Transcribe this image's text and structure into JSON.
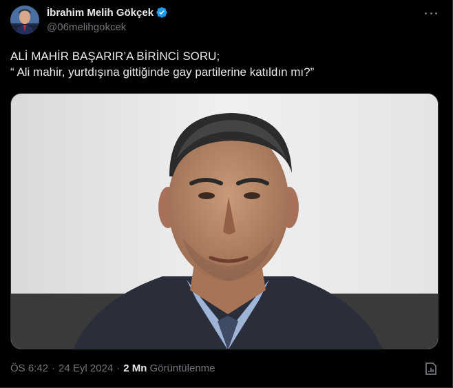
{
  "author": {
    "display_name": "İbrahim Melih Gökçek",
    "handle": "@06melihgokcek",
    "verified_color": "#1d9bf0"
  },
  "tweet": {
    "line1": "ALİ MAHİR BAŞARIR’A BİRİNCİ SORU;",
    "line2": "“ Ali mahir, yurtdışına gittiğinde gay partilerine katıldın mı?”"
  },
  "media": {
    "description_icon": "portrait-photo"
  },
  "meta": {
    "time": "ÖS 6:42",
    "separator": "·",
    "date": "24 Eyl 2024",
    "views_count": "2 Mn",
    "views_label": "Görüntülenme"
  },
  "icons": {
    "more": "more-icon",
    "analytics": "analytics-icon",
    "verified": "verified-badge-icon"
  },
  "colors": {
    "background": "#000000",
    "text": "#e7e9ea",
    "secondary": "#71767b",
    "accent": "#1d9bf0"
  }
}
